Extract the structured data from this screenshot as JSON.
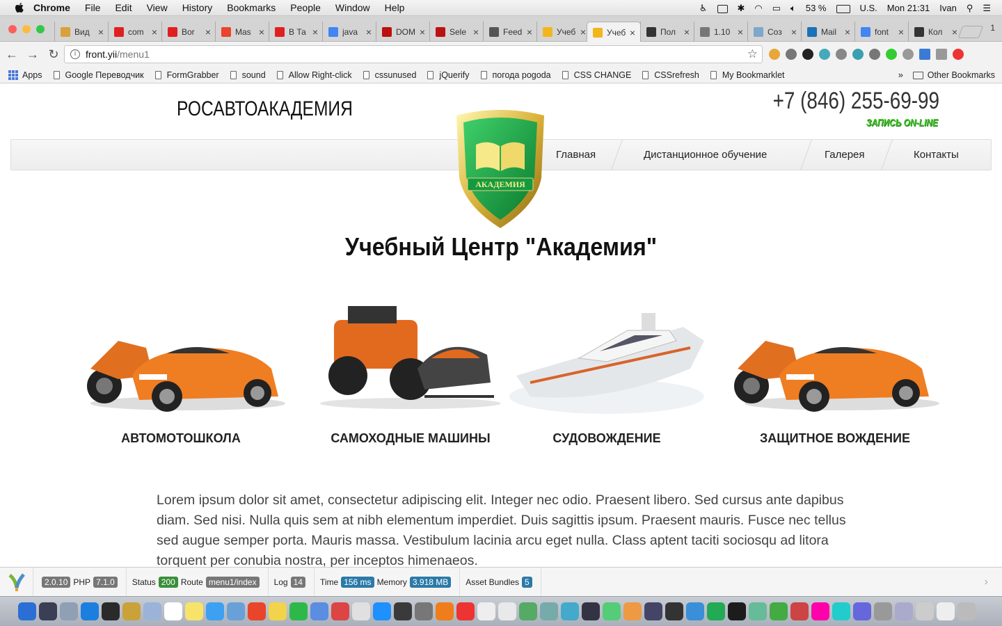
{
  "menubar": {
    "app": "Chrome",
    "items": [
      "File",
      "Edit",
      "View",
      "History",
      "Bookmarks",
      "People",
      "Window",
      "Help"
    ],
    "battery": "53 %",
    "input_source": "U.S.",
    "datetime": "Mon 21:31",
    "user": "Ivan"
  },
  "tabs": [
    {
      "title": "Вид",
      "color": "#d8a23b"
    },
    {
      "title": "com",
      "color": "#e02020"
    },
    {
      "title": "Bor",
      "color": "#e02020"
    },
    {
      "title": "Mas",
      "color": "#e8452a"
    },
    {
      "title": "В Та",
      "color": "#e02020"
    },
    {
      "title": "java",
      "color": "#4285f4"
    },
    {
      "title": "DOM",
      "color": "#b11"
    },
    {
      "title": "Sele",
      "color": "#b11"
    },
    {
      "title": "Feed",
      "color": "#555"
    },
    {
      "title": "Учеб",
      "color": "#f2b61c"
    },
    {
      "title": "Учеб",
      "color": "#f2b61c"
    },
    {
      "title": "Пол",
      "color": "#333"
    },
    {
      "title": "1.10",
      "color": "#777"
    },
    {
      "title": "Соз",
      "color": "#7fa7c8"
    },
    {
      "title": "Mail",
      "color": "#1a72b8"
    },
    {
      "title": "font",
      "color": "#4285f4"
    },
    {
      "title": "Кол",
      "color": "#333"
    }
  ],
  "tabs_extra": "1",
  "address": {
    "host": "front.yii",
    "path": "/menu1"
  },
  "bookmarks": {
    "apps": "Apps",
    "items": [
      "Google Переводчик",
      "FormGrabber",
      "sound",
      "Allow Right-click",
      "cssunused",
      "jQuerify",
      "погода pogoda",
      "CSS CHANGE",
      "CSSrefresh",
      "My Bookmarklet"
    ],
    "overflow": "»",
    "other": "Other Bookmarks"
  },
  "site": {
    "brand": "РОСАВТОАКАДЕМИЯ",
    "phone": "+7 (846) 255-69-99",
    "signup": "ЗАПИСЬ ON-LINE",
    "logo_text": "АКАДЕМИЯ",
    "nav": [
      "Главная",
      "Дистанционное обучение",
      "Галерея",
      "Контакты"
    ],
    "title": "Учебный Центр \"Академия\"",
    "cards": [
      {
        "caption": "АВТОМОТОШКОЛА",
        "image": "car-and-motorcycle"
      },
      {
        "caption": "САМОХОДНЫЕ МАШИНЫ",
        "image": "atv-and-snowmobile"
      },
      {
        "caption": "СУДОВОЖДЕНИЕ",
        "image": "yacht"
      },
      {
        "caption": "ЗАЩИТНОЕ ВОЖДЕНИЕ",
        "image": "car-and-motorcycle"
      }
    ],
    "lorem": "Lorem ipsum dolor sit amet, consectetur adipiscing elit. Integer nec odio. Praesent libero. Sed cursus ante dapibus diam. Sed nisi. Nulla quis sem at nibh elementum imperdiet. Duis sagittis ipsum. Praesent mauris. Fusce nec tellus sed augue semper porta. Mauris massa. Vestibulum lacinia arcu eget nulla. Class aptent taciti sociosqu ad litora torquent per conubia nostra, per inceptos himenaeos."
  },
  "debugbar": {
    "yii_version": "2.0.10",
    "php_label": "PHP",
    "php_version": "7.1.0",
    "status_label": "Status",
    "status": "200",
    "route_label": "Route",
    "route": "menu1/index",
    "log_label": "Log",
    "log": "14",
    "time_label": "Time",
    "time": "156 ms",
    "memory_label": "Memory",
    "memory": "3.918 MB",
    "assets_label": "Asset Bundles",
    "assets": "5"
  },
  "dock_colors": [
    "#2b6fd6",
    "#3a3f55",
    "#8fa0b5",
    "#1c7fe0",
    "#2a2a2a",
    "#c9a23a",
    "#9bb3d8",
    "#fff",
    "#f7e36a",
    "#3ea0f0",
    "#6aa0d8",
    "#e8452a",
    "#f2d34c",
    "#2fb84a",
    "#5b8de0",
    "#d44",
    "#e0e0e0",
    "#1e90ff",
    "#3a3a3a",
    "#777",
    "#ef7d1a",
    "#e33",
    "#eee",
    "#e9e9e9",
    "#5a6",
    "#7aa",
    "#4ac",
    "#334",
    "#5c7",
    "#e94",
    "#446",
    "#333",
    "#3a8fd8",
    "#2a5",
    "#1c1c1c",
    "#6b9",
    "#4a4",
    "#c44",
    "#f0a",
    "#2cc",
    "#66d",
    "#999",
    "#aac",
    "#ccc",
    "#eee",
    "#bbb"
  ]
}
